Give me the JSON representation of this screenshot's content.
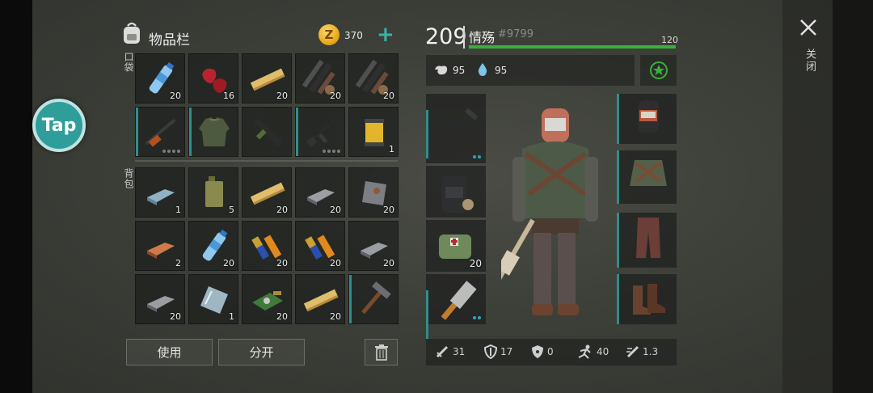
{
  "header": {
    "title": "物品栏",
    "coins": "370",
    "add_label": "+"
  },
  "tap_button": "Tap",
  "sections": {
    "pocket": "口袋",
    "backpack": "背包"
  },
  "pocket_items": [
    {
      "icon": "water-bottle-icon",
      "qty": "20"
    },
    {
      "icon": "raw-meat-icon",
      "qty": "16"
    },
    {
      "icon": "wood-plank-icon",
      "qty": "20"
    },
    {
      "icon": "pipe-fittings-icon",
      "qty": "20"
    },
    {
      "icon": "pipe-fittings-icon",
      "qty": "20"
    },
    {
      "icon": "rifle-icon",
      "qty": ""
    },
    {
      "icon": "jacket-icon",
      "qty": ""
    },
    {
      "icon": "submachine-gun-icon",
      "qty": ""
    },
    {
      "icon": "assault-rifle-icon",
      "qty": ""
    },
    {
      "icon": "air-filter-icon",
      "qty": "1"
    }
  ],
  "backpack_items": [
    {
      "icon": "aluminum-bar-icon",
      "qty": "1"
    },
    {
      "icon": "fuel-canister-icon",
      "qty": "5"
    },
    {
      "icon": "wood-plank-icon",
      "qty": "20"
    },
    {
      "icon": "iron-bar-icon",
      "qty": "20"
    },
    {
      "icon": "metal-sheet-icon",
      "qty": "20"
    },
    {
      "icon": "copper-bar-icon",
      "qty": "2"
    },
    {
      "icon": "water-bottle-icon",
      "qty": "20"
    },
    {
      "icon": "battery-icon",
      "qty": "20"
    },
    {
      "icon": "battery-icon",
      "qty": "20"
    },
    {
      "icon": "iron-bar-icon",
      "qty": "20"
    },
    {
      "icon": "iron-bar-icon",
      "qty": "20"
    },
    {
      "icon": "glass-sheet-icon",
      "qty": "1"
    },
    {
      "icon": "circuit-board-icon",
      "qty": "20"
    },
    {
      "icon": "wood-plank-icon",
      "qty": "20"
    },
    {
      "icon": "hammer-icon",
      "qty": ""
    }
  ],
  "buttons": {
    "use": "使用",
    "split": "分开"
  },
  "player": {
    "level": "209",
    "name": "情殇",
    "id": "#9799",
    "hp": "120",
    "hunger": "95",
    "thirst": "95"
  },
  "equipment": {
    "medkit_qty": "20"
  },
  "combat_stats": {
    "attack": "31",
    "defense": "17",
    "radiation": "0",
    "speed": "40",
    "attack_speed": "1.3"
  },
  "close_label": "关闭",
  "colors": {
    "accent": "#39b3a6",
    "hp_bar": "#3ab03a",
    "coin": "#e3a313"
  }
}
